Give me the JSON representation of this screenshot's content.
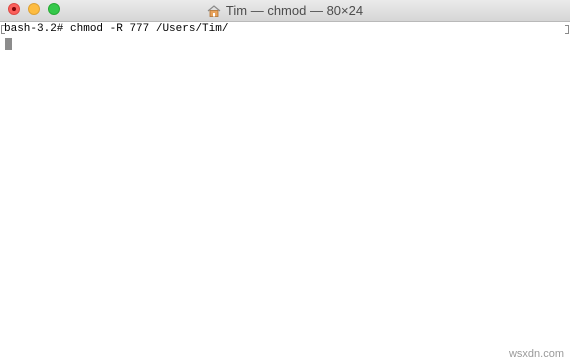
{
  "window": {
    "title": "Tim — chmod — 80×24"
  },
  "terminal": {
    "prompt": "bash-3.2#",
    "command": "chmod -R 777 /Users/Tim/"
  },
  "watermark": "wsxdn.com",
  "colors": {
    "close": "#fc605c",
    "minimize": "#fdbc40",
    "zoom": "#34c84a",
    "cursor": "#8c8c8c"
  },
  "icons": {
    "title": "home-folder-icon"
  }
}
